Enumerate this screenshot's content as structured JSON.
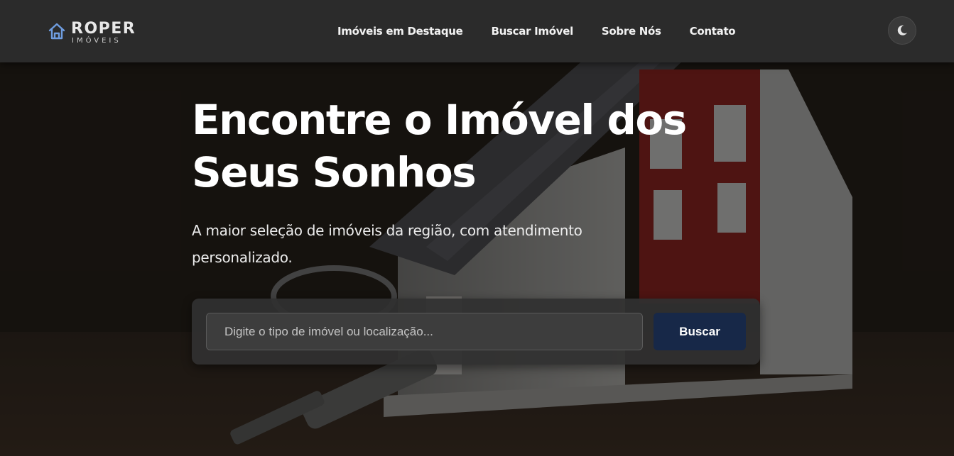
{
  "brand": {
    "name": "ROPER",
    "tagline": "IMÓVEIS"
  },
  "nav": {
    "items": [
      {
        "label": "Imóveis em Destaque"
      },
      {
        "label": "Buscar Imóvel"
      },
      {
        "label": "Sobre Nós"
      },
      {
        "label": "Contato"
      }
    ],
    "theme_toggle_icon": "moon-icon"
  },
  "hero": {
    "title": "Encontre o Imóvel dos Seus Sonhos",
    "subtitle": "A maior seleção de imóveis da região, com atendimento personalizado.",
    "background": "house-model-with-keys-photo"
  },
  "search": {
    "placeholder": "Digite o tipo de imóvel ou localização...",
    "value": "",
    "button_label": "Buscar"
  },
  "colors": {
    "header_bg": "#2b2b2b",
    "accent_logo": "#6f9de0",
    "search_button": "#172848",
    "text": "#ffffff"
  }
}
